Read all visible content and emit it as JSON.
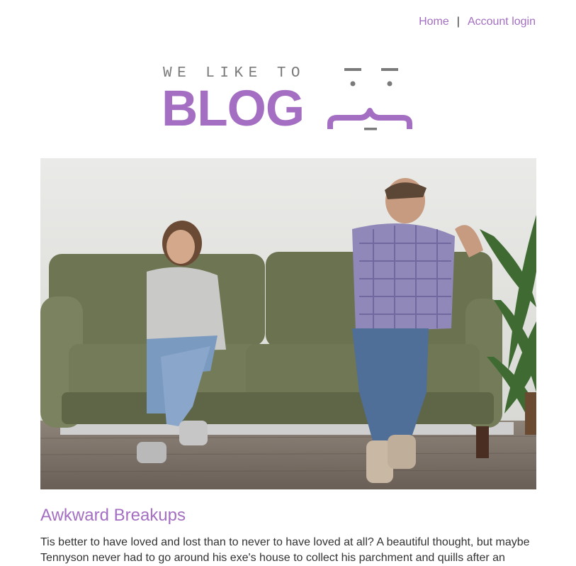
{
  "nav": {
    "home_label": "Home",
    "separator": "|",
    "account_label": "Account login"
  },
  "logo": {
    "tagline": "WE LIKE TO",
    "brand": "BLOG",
    "accent_color": "#a46fc2",
    "tagline_color": "#7a7a7a"
  },
  "hero": {
    "icon": "photo-couple-sitting-apart-on-sofa"
  },
  "post": {
    "title": "Awkward Breakups",
    "excerpt": "Tis better to have loved and lost than to never to have loved at all? A beautiful thought, but maybe Tennyson never had to go around his exe's house to collect his parchment and quills after an"
  }
}
